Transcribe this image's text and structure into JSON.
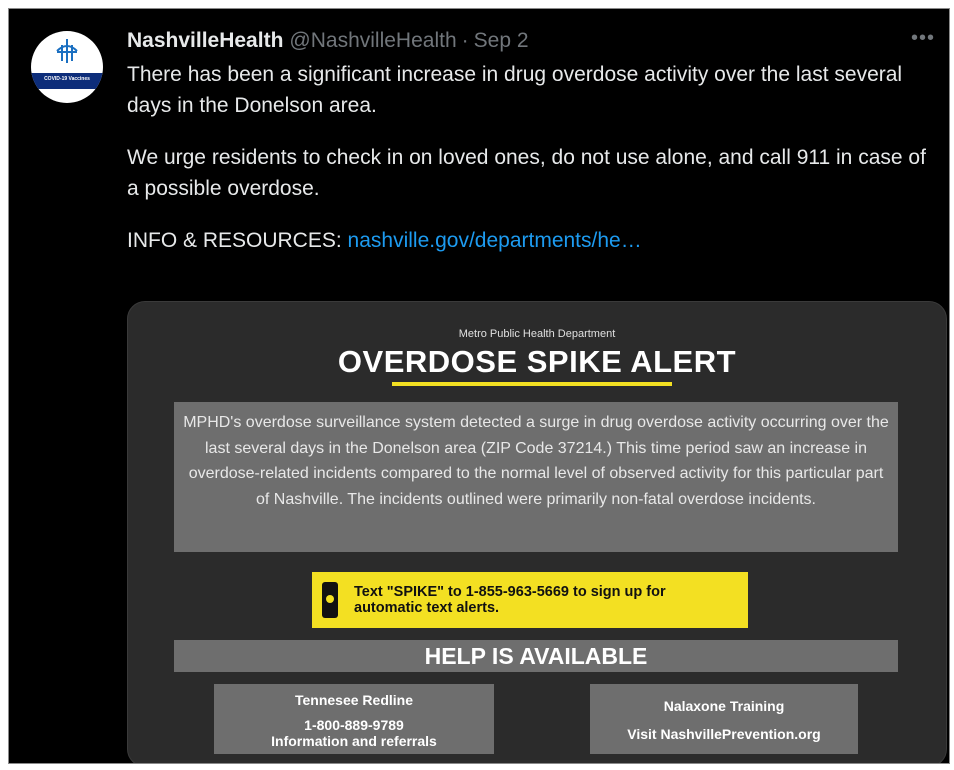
{
  "tweet": {
    "author_name": "NashvilleHealth",
    "handle": "@NashvilleHealth",
    "separator": "·",
    "date": "Sep 2",
    "more_icon": "more-horizontal-icon",
    "avatar_banner": "COVID-19 Vaccines",
    "paragraph1": "There has been a significant increase in drug overdose activity over the last several days in the Donelson area.",
    "paragraph2": "We urge residents to check in on loved ones, do not use alone, and call 911 in case of a possible overdose.",
    "resources_label": "INFO & RESOURCES:",
    "resources_link": "nashville.gov/departments/he…"
  },
  "card": {
    "department": "Metro Public Health Department",
    "title": "OVERDOSE SPIKE ALERT",
    "description": "MPHD's overdose surveillance system detected a surge in drug overdose activity occurring over the last several days in the Donelson area (ZIP Code 37214.) This time period saw an increase in overdose-related incidents compared to the normal level of observed activity for this particular part of Nashville. The incidents outlined were primarily non-fatal overdose incidents.",
    "sms_text": "Text \"SPIKE\" to 1-855-963-5669 to sign up for automatic text alerts.",
    "help_title": "HELP IS AVAILABLE",
    "redline_title": "Tennesee Redline",
    "redline_phone": "1-800-889-9789",
    "redline_desc": "Information and referrals",
    "nalaxone_title": "Nalaxone Training",
    "nalaxone_link": "Visit NashvillePrevention.org"
  },
  "colors": {
    "background": "#000000",
    "link": "#1d9bf0",
    "accent_yellow": "#f3e022",
    "panel_gray": "#6e6e6e"
  }
}
